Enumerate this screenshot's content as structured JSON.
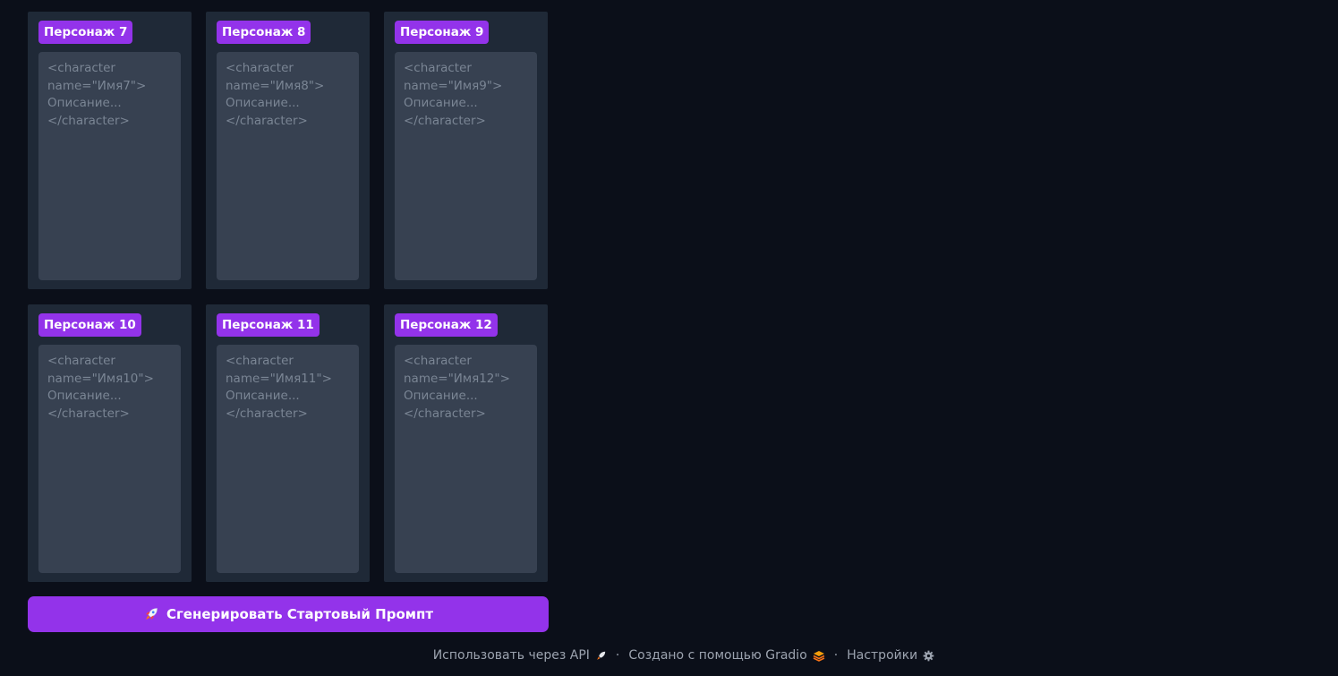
{
  "characters": [
    {
      "label": "Персонаж 7",
      "placeholder": "<character name=\"Имя7\">\nОписание...\n</character>",
      "value": ""
    },
    {
      "label": "Персонаж 8",
      "placeholder": "<character name=\"Имя8\">\nОписание...\n</character>",
      "value": ""
    },
    {
      "label": "Персонаж 9",
      "placeholder": "<character name=\"Имя9\">\nОписание...\n</character>",
      "value": ""
    },
    {
      "label": "Персонаж 10",
      "placeholder": "<character name=\"Имя10\">\nОписание...\n</character>",
      "value": ""
    },
    {
      "label": "Персонаж 11",
      "placeholder": "<character name=\"Имя11\">\nОписание...\n</character>",
      "value": ""
    },
    {
      "label": "Персонаж 12",
      "placeholder": "<character name=\"Имя12\">\nОписание...\n</character>",
      "value": ""
    }
  ],
  "generate_button": {
    "label": "Сгенерировать Стартовый Промпт",
    "icon": "rocket-icon"
  },
  "footer": {
    "api_label": "Использовать через API",
    "api_icon": "rocket-icon",
    "gradio_label": "Создано с помощью Gradio",
    "gradio_icon": "gradio-logo-icon",
    "settings_label": "Настройки",
    "settings_icon": "gear-icon",
    "separator": "·"
  },
  "colors": {
    "background": "#0b0f19",
    "card": "#1f2937",
    "textarea": "#374151",
    "accent": "#9333ea",
    "footer_text": "#9ca3af"
  }
}
